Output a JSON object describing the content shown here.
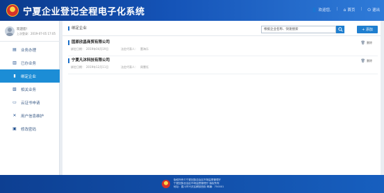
{
  "header": {
    "site_title": "宁夏企业登记全程电子化系统",
    "user_greeting": "欢迎您,",
    "home_label": "首页",
    "logout_label": "退出",
    "separator": "|"
  },
  "sidebar": {
    "welcome": "欢迎您!",
    "last_login": "上次登录：2019-07-05 17:05",
    "items": [
      {
        "label": "业务办理",
        "icon": "document-icon",
        "active": false
      },
      {
        "label": "已办业务",
        "icon": "bar-chart-icon",
        "active": false
      },
      {
        "label": "绑定企业",
        "icon": "building-icon",
        "active": true
      },
      {
        "label": "相关业务",
        "icon": "folder-icon",
        "active": false
      },
      {
        "label": "云证书申请",
        "icon": "certificate-icon",
        "active": false
      },
      {
        "label": "用户信息维护",
        "icon": "tools-icon",
        "active": false
      },
      {
        "label": "修改密码",
        "icon": "lock-icon",
        "active": false
      }
    ]
  },
  "main": {
    "title": "绑定企业",
    "search_placeholder": "根据企业名称、快速搜索",
    "add_label": "+ 添加",
    "date_label": "绑定日期：",
    "rep_label": "法定代表人：",
    "delete_label": "删除",
    "companies": [
      {
        "name": "固原欣昌商贸有限公司",
        "date": "2019年04月19日",
        "rep": "董海乐"
      },
      {
        "name": "宁夏凡沐科技有限公司",
        "date": "2019年12月11日",
        "rep": "周慧钰"
      }
    ]
  },
  "footer": {
    "lines": [
      "版权所有©宁夏回族自治区市场监督管理厅",
      "宁夏回族自治区市场监督管理厅 版权所有",
      "地址：银川市兴庆区解放西街 邮编：750001"
    ]
  },
  "colors": {
    "header_start": "#0b3a8c",
    "header_end": "#2f7bd8",
    "accent": "#1c8dd6",
    "button": "#1f7fd0"
  }
}
